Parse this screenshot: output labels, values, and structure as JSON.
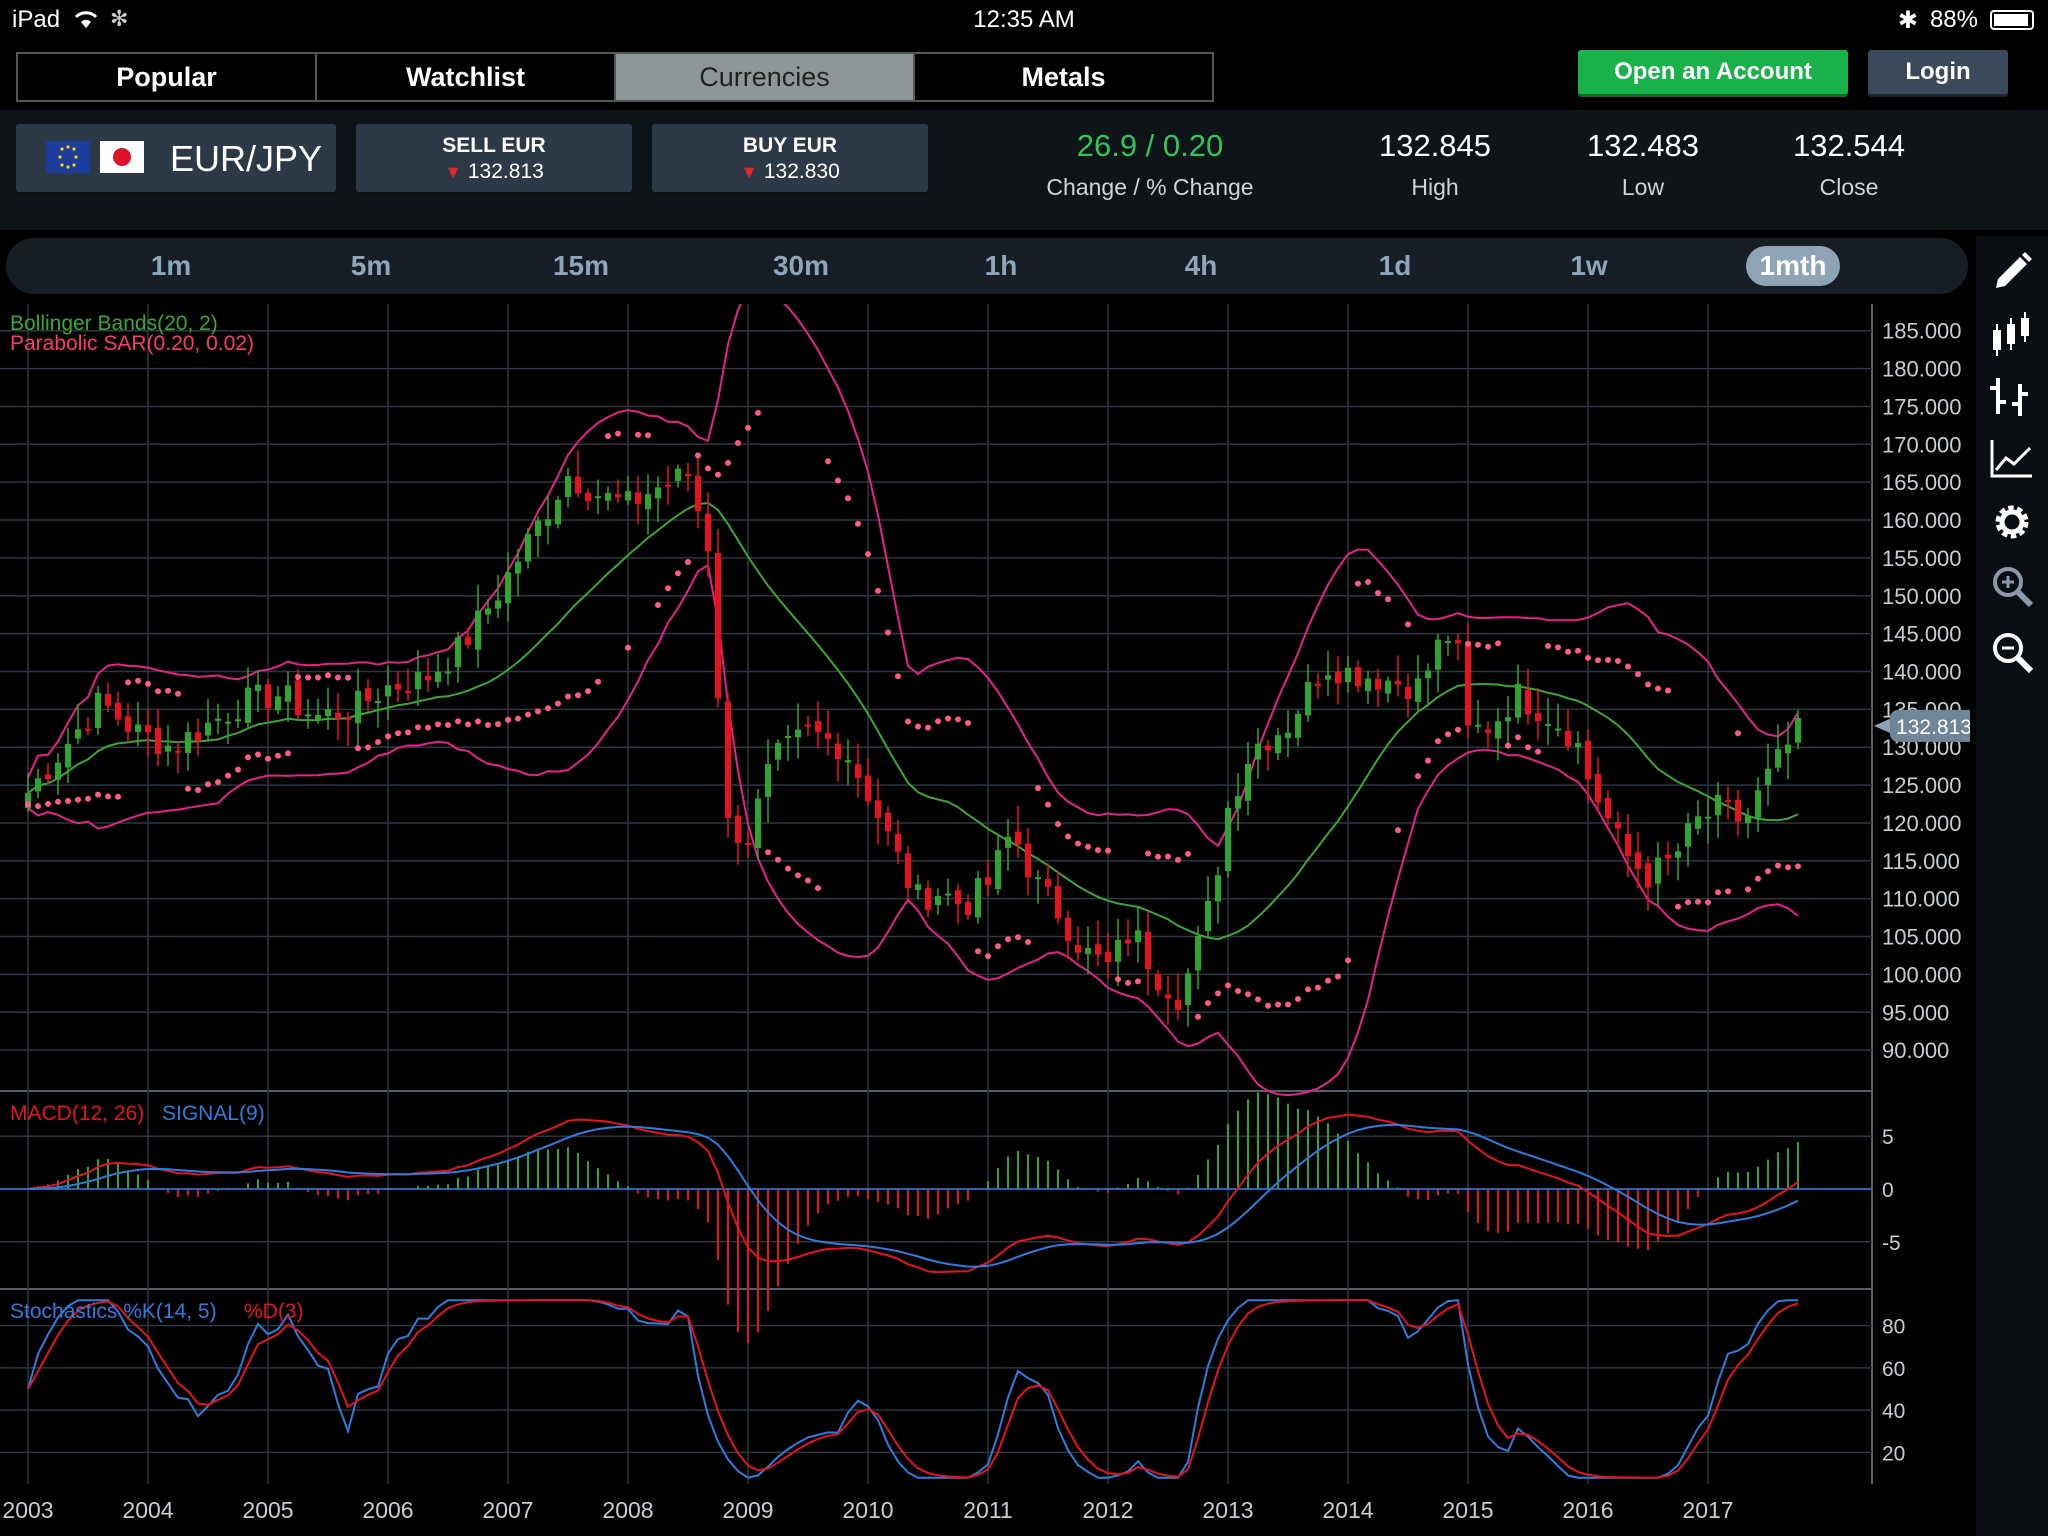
{
  "status_bar": {
    "device": "iPad",
    "time": "12:35 AM",
    "battery": "88%"
  },
  "tabs": [
    "Popular",
    "Watchlist",
    "Currencies",
    "Metals"
  ],
  "active_tab": "Currencies",
  "header_buttons": {
    "open_account": "Open an Account",
    "login": "Login"
  },
  "instrument": {
    "pair": "EUR/JPY"
  },
  "sell": {
    "label": "SELL EUR",
    "price": "132.813"
  },
  "buy": {
    "label": "BUY EUR",
    "price": "132.830"
  },
  "stats": {
    "change": "26.9 / 0.20",
    "change_label": "Change / % Change",
    "high": "132.845",
    "high_label": "High",
    "low": "132.483",
    "low_label": "Low",
    "close": "132.544",
    "close_label": "Close"
  },
  "timeframes": [
    "1m",
    "5m",
    "15m",
    "30m",
    "1h",
    "4h",
    "1d",
    "1w",
    "1mth"
  ],
  "active_timeframe": "1mth",
  "toolbar_icons": [
    "pencil-icon",
    "candlestick-icon",
    "bar-chart-icon",
    "line-chart-icon",
    "gear-icon",
    "zoom-in-icon",
    "zoom-out-icon"
  ],
  "colors": {
    "up": "#2ea52e",
    "down": "#e8121e",
    "band": "#e8208a",
    "middle": "#39a832",
    "sar": "#ff5a82",
    "macd": "#e8121e",
    "signal": "#2c7de0",
    "k": "#2c7de0",
    "d": "#e8121e",
    "accent": "#19b24a"
  },
  "chart_data": {
    "type": "candlestick",
    "indicators": {
      "main": [
        "Bollinger Bands(20, 2)",
        "Parabolic SAR(0.20, 0.02)"
      ],
      "macd": {
        "macd_label": "MACD(12, 26)",
        "signal_label": "SIGNAL(9)"
      },
      "stochastic": {
        "k_label": "Stochastics %K(14, 5)",
        "d_label": "%D(3)"
      }
    },
    "x_ticks": [
      "2003",
      "2004",
      "2005",
      "2006",
      "2007",
      "2008",
      "2009",
      "2010",
      "2011",
      "2012",
      "2013",
      "2014",
      "2015",
      "2016",
      "2017"
    ],
    "price_axis": [
      "185.000",
      "180.000",
      "175.000",
      "170.000",
      "165.000",
      "160.000",
      "155.000",
      "150.000",
      "145.000",
      "140.000",
      "135.000",
      "130.000",
      "125.000",
      "120.000",
      "115.000",
      "110.000",
      "105.000",
      "100.000",
      "95.000",
      "90.000"
    ],
    "price_range": [
      85,
      188
    ],
    "macd_axis": [
      "5",
      "0",
      "-5"
    ],
    "macd_range": [
      -9,
      9
    ],
    "stoch_axis": [
      "80",
      "60",
      "40",
      "20"
    ],
    "stoch_range": [
      5,
      95
    ],
    "last_price": "132.813",
    "close_path": [
      [
        2003.0,
        124
      ],
      [
        2003.3,
        130
      ],
      [
        2003.6,
        136
      ],
      [
        2003.9,
        132
      ],
      [
        2004.2,
        130
      ],
      [
        2004.5,
        133
      ],
      [
        2004.8,
        136
      ],
      [
        2005.1,
        137
      ],
      [
        2005.4,
        134
      ],
      [
        2005.7,
        135
      ],
      [
        2006.0,
        138
      ],
      [
        2006.3,
        139
      ],
      [
        2006.6,
        143
      ],
      [
        2006.9,
        150
      ],
      [
        2007.2,
        158
      ],
      [
        2007.5,
        166
      ],
      [
        2007.8,
        163
      ],
      [
        2008.0,
        162
      ],
      [
        2008.2,
        164
      ],
      [
        2008.5,
        166
      ],
      [
        2008.7,
        155
      ],
      [
        2008.8,
        120
      ],
      [
        2009.0,
        118
      ],
      [
        2009.2,
        128
      ],
      [
        2009.5,
        132
      ],
      [
        2009.8,
        130
      ],
      [
        2010.0,
        124
      ],
      [
        2010.2,
        117
      ],
      [
        2010.4,
        110
      ],
      [
        2010.6,
        111
      ],
      [
        2010.8,
        109
      ],
      [
        2011.0,
        112
      ],
      [
        2011.2,
        119
      ],
      [
        2011.4,
        112
      ],
      [
        2011.6,
        108
      ],
      [
        2011.8,
        103
      ],
      [
        2012.0,
        101
      ],
      [
        2012.2,
        106
      ],
      [
        2012.4,
        100
      ],
      [
        2012.6,
        97
      ],
      [
        2012.8,
        106
      ],
      [
        2012.9,
        113
      ],
      [
        2013.0,
        122
      ],
      [
        2013.2,
        130
      ],
      [
        2013.5,
        133
      ],
      [
        2013.8,
        141
      ],
      [
        2014.0,
        140
      ],
      [
        2014.3,
        139
      ],
      [
        2014.6,
        138
      ],
      [
        2014.8,
        145
      ],
      [
        2014.9,
        144
      ],
      [
        2015.0,
        132
      ],
      [
        2015.2,
        133
      ],
      [
        2015.4,
        137
      ],
      [
        2015.7,
        134
      ],
      [
        2015.9,
        131
      ],
      [
        2016.0,
        126
      ],
      [
        2016.3,
        116
      ],
      [
        2016.5,
        113
      ],
      [
        2016.7,
        115
      ],
      [
        2016.9,
        120
      ],
      [
        2017.1,
        122
      ],
      [
        2017.3,
        120
      ],
      [
        2017.5,
        126
      ],
      [
        2017.7,
        131
      ],
      [
        2017.8,
        132.8
      ]
    ]
  }
}
